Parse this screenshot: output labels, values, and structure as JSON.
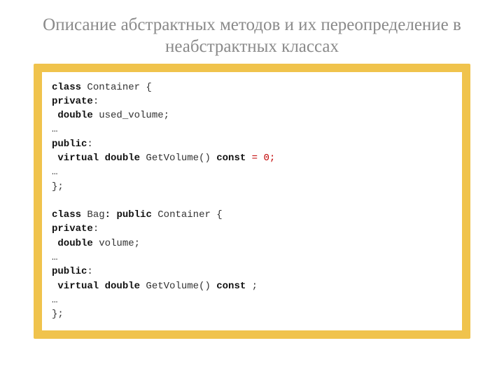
{
  "title": "Описание абстрактных методов и их переопределение в неабстрактных классах",
  "code": {
    "l01_kw1": "class",
    "l01_t1": " Container {",
    "l02_kw1": "private",
    "l02_t1": ":",
    "l03_kw1": " double",
    "l03_t1": " used_volume;",
    "l04_t1": "…",
    "l05_kw1": "public",
    "l05_t1": ":",
    "l06_kw1": " virtual double",
    "l06_t1": " GetVolume() ",
    "l06_kw2": "const",
    "l06_t2": " ",
    "l06_red": "= 0;",
    "l07_t1": "…",
    "l08_t1": "};",
    "l09_blank": " ",
    "l10_kw1": "class",
    "l10_t1": " Bag",
    "l10_kw2": ":",
    "l10_t2": " ",
    "l10_kw3": "public",
    "l10_t3": " Container {",
    "l11_kw1": "private",
    "l11_t1": ":",
    "l12_kw1": " double",
    "l12_t1": " volume;",
    "l13_t1": "…",
    "l14_kw1": "public",
    "l14_t1": ":",
    "l15_kw1": " virtual double",
    "l15_t1": " GetVolume() ",
    "l15_kw2": "const",
    "l15_t2": " ;",
    "l16_t1": "…",
    "l17_t1": "};"
  }
}
